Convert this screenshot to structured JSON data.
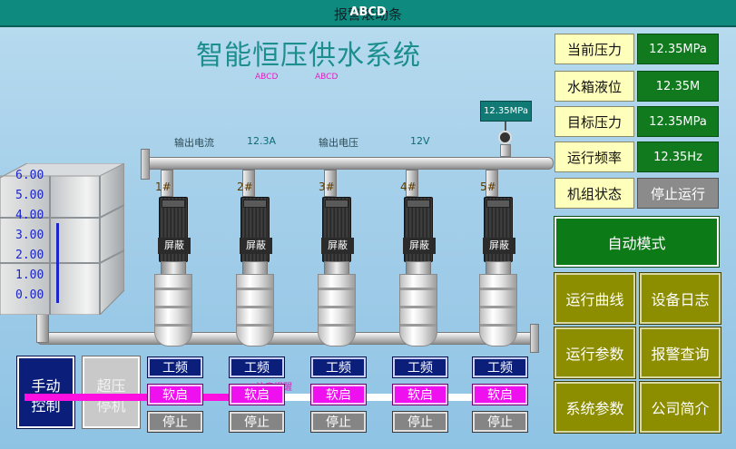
{
  "window": {
    "alarm_text": "报警滚动条",
    "alarm_overlay": "ABCD"
  },
  "main_title": "智能恒压供水系统",
  "placeholders": [
    "ABCD",
    "ABCD"
  ],
  "readouts": {
    "output_current_label": "输出电流",
    "output_current_value": "12.3A",
    "output_voltage_label": "输出电压",
    "output_voltage_value": "12V",
    "pressure_gauge_value": "12.35MPa"
  },
  "status_panel": [
    {
      "label": "当前压力",
      "value": "12.35MPa"
    },
    {
      "label": "水箱液位",
      "value": "12.35M"
    },
    {
      "label": "目标压力",
      "value": "12.35MPa"
    },
    {
      "label": "运行频率",
      "value": "12.35Hz"
    },
    {
      "label": "机组状态",
      "value": "停止运行"
    }
  ],
  "auto_mode_label": "自动模式",
  "nav_buttons": [
    "运行曲线",
    "设备日志",
    "运行参数",
    "报警查询",
    "系统参数",
    "公司简介"
  ],
  "tank_ticks": [
    "6.00",
    "5.00",
    "4.00",
    "3.00",
    "2.00",
    "1.00",
    "0.00"
  ],
  "pumps": [
    {
      "num": "1#",
      "shield": "屏蔽",
      "mode_label": "工频",
      "soft_label": "软启",
      "stop_label": "停止"
    },
    {
      "num": "2#",
      "shield": "屏蔽",
      "mode_label": "工频",
      "soft_label": "软启",
      "stop_label": "停止"
    },
    {
      "num": "3#",
      "shield": "屏蔽",
      "mode_label": "工频",
      "soft_label": "软启",
      "stop_label": "停止"
    },
    {
      "num": "4#",
      "shield": "屏蔽",
      "mode_label": "工频",
      "soft_label": "软启",
      "stop_label": "停止"
    },
    {
      "num": "5#",
      "shield": "屏蔽",
      "mode_label": "工频",
      "soft_label": "软启",
      "stop_label": "停止"
    }
  ],
  "manual_button": "手动\n控制",
  "overpress_button": "超压\n停机",
  "overlay_note": "注意提醒",
  "colors": {
    "title_bar": "#0e8a7e",
    "value_green": "#117a1f",
    "label_yellow": "#ffffbc",
    "nav_olive": "#8d8d00",
    "pump_navy": "#0b1f7a",
    "pump_magenta": "#ee10ee"
  }
}
